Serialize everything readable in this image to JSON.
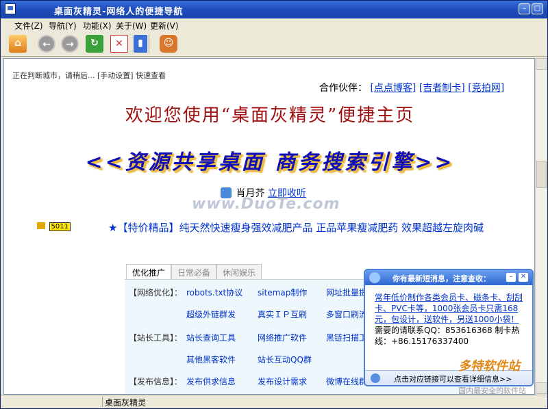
{
  "window": {
    "title": "桌面灰精灵-网络人的便捷导航"
  },
  "menu": [
    {
      "label": "文件(Z)"
    },
    {
      "label": "导航(Y)"
    },
    {
      "label": "功能(X)"
    },
    {
      "label": "关于(W)"
    },
    {
      "label": "更新(V)"
    }
  ],
  "toolbar": [
    "home-icon",
    "back-icon",
    "forward-icon",
    "refresh-icon",
    "stop-icon",
    "exit-icon",
    "users-icon"
  ],
  "content": {
    "status_line": "正在判断城市，请稍后...  [手动设置] 快速查看",
    "partner_label": "合作伙伴：",
    "partners": [
      "[点点博客]",
      "[吉者制卡]",
      "[竞拍网]"
    ],
    "welcome": "欢迎您使用“桌面灰精灵”便捷主页",
    "slogan": "<<资源共享桌面   商务搜索引擎>>",
    "radio_name": "肖月芥",
    "radio_link": "立即收听",
    "watermark": "www.DuoTe.com",
    "badge_num": "5011",
    "ticker": "★【特价精品】纯天然快速瘦身强效减肥产品 正品苹果瘦减肥药 效果超越左旋肉碱"
  },
  "tabs": [
    {
      "label": "优化推广",
      "active": true
    },
    {
      "label": "日常必备",
      "active": false
    },
    {
      "label": "休闲娱乐",
      "active": false
    }
  ],
  "panel": {
    "rows": [
      {
        "category": "【网络优化】：",
        "links": [
          "robots.txt协议",
          "sitemap制作",
          "网址批量提"
        ]
      },
      {
        "category": "",
        "links": [
          "超级外链群发",
          "真实ＩＰ互刷",
          "多窗口刷流"
        ]
      },
      {
        "category": "【站长工具】：",
        "links": [
          "站长查询工具",
          "网络推广软件",
          "黑链扫描工"
        ]
      },
      {
        "category": "",
        "links": [
          "其他黑客软件",
          "站长互动QQ群"
        ]
      },
      {
        "category": "【发布信息】：",
        "links": [
          "发布供求信息",
          "发布设计需求",
          "微博在线群"
        ]
      }
    ]
  },
  "popup": {
    "title": "你有最新短消息，注意查收：",
    "ad_text": "常年低价制作各类会员卡、磁条卡、刮刮卡、PVC卡等，1000张会员卡只需168元，包设计，送软件，另送1000小袋！",
    "contact": "需要的请联系QQ：853616368 制卡热线：+86.15176337400",
    "footer": "点击对应链接可以查看详细信息>>"
  },
  "brand": {
    "name": "多特软件站",
    "sub": "国内最安全的软件站"
  },
  "statusbar": {
    "text": "桌面灰精灵"
  }
}
